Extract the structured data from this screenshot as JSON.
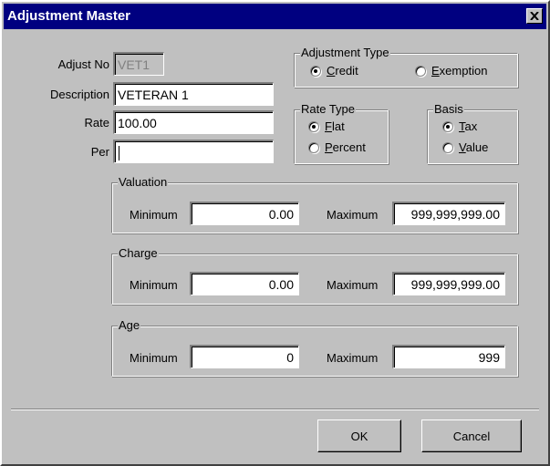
{
  "window": {
    "title": "Adjustment Master",
    "close_label": "×"
  },
  "fields": {
    "adjust_no": {
      "label": "Adjust No",
      "value": "VET1"
    },
    "description": {
      "label": "Description",
      "value": "VETERAN 1"
    },
    "rate": {
      "label": "Rate",
      "value": "100.00"
    },
    "per": {
      "label": "Per",
      "value": ""
    }
  },
  "adjustment_type": {
    "title": "Adjustment Type",
    "options": [
      {
        "label_first": "C",
        "label_rest": "redit",
        "checked": true
      },
      {
        "label_first": "E",
        "label_rest": "xemption",
        "checked": false
      }
    ]
  },
  "rate_type": {
    "title": "Rate Type",
    "options": [
      {
        "label_first": "F",
        "label_rest": "lat",
        "checked": true
      },
      {
        "label_first": "P",
        "label_rest": "ercent",
        "checked": false
      }
    ]
  },
  "basis": {
    "title": "Basis",
    "options": [
      {
        "label_first": "T",
        "label_rest": "ax",
        "checked": true
      },
      {
        "label_first": "V",
        "label_rest": "alue",
        "checked": false
      }
    ]
  },
  "valuation": {
    "title": "Valuation",
    "min_label": "Minimum",
    "min_value": "0.00",
    "max_label": "Maximum",
    "max_value": "999,999,999.00"
  },
  "charge": {
    "title": "Charge",
    "min_label": "Minimum",
    "min_value": "0.00",
    "max_label": "Maximum",
    "max_value": "999,999,999.00"
  },
  "age": {
    "title": "Age",
    "min_label": "Minimum",
    "min_value": "0",
    "max_label": "Maximum",
    "max_value": "999"
  },
  "buttons": {
    "ok": "OK",
    "cancel": "Cancel"
  }
}
